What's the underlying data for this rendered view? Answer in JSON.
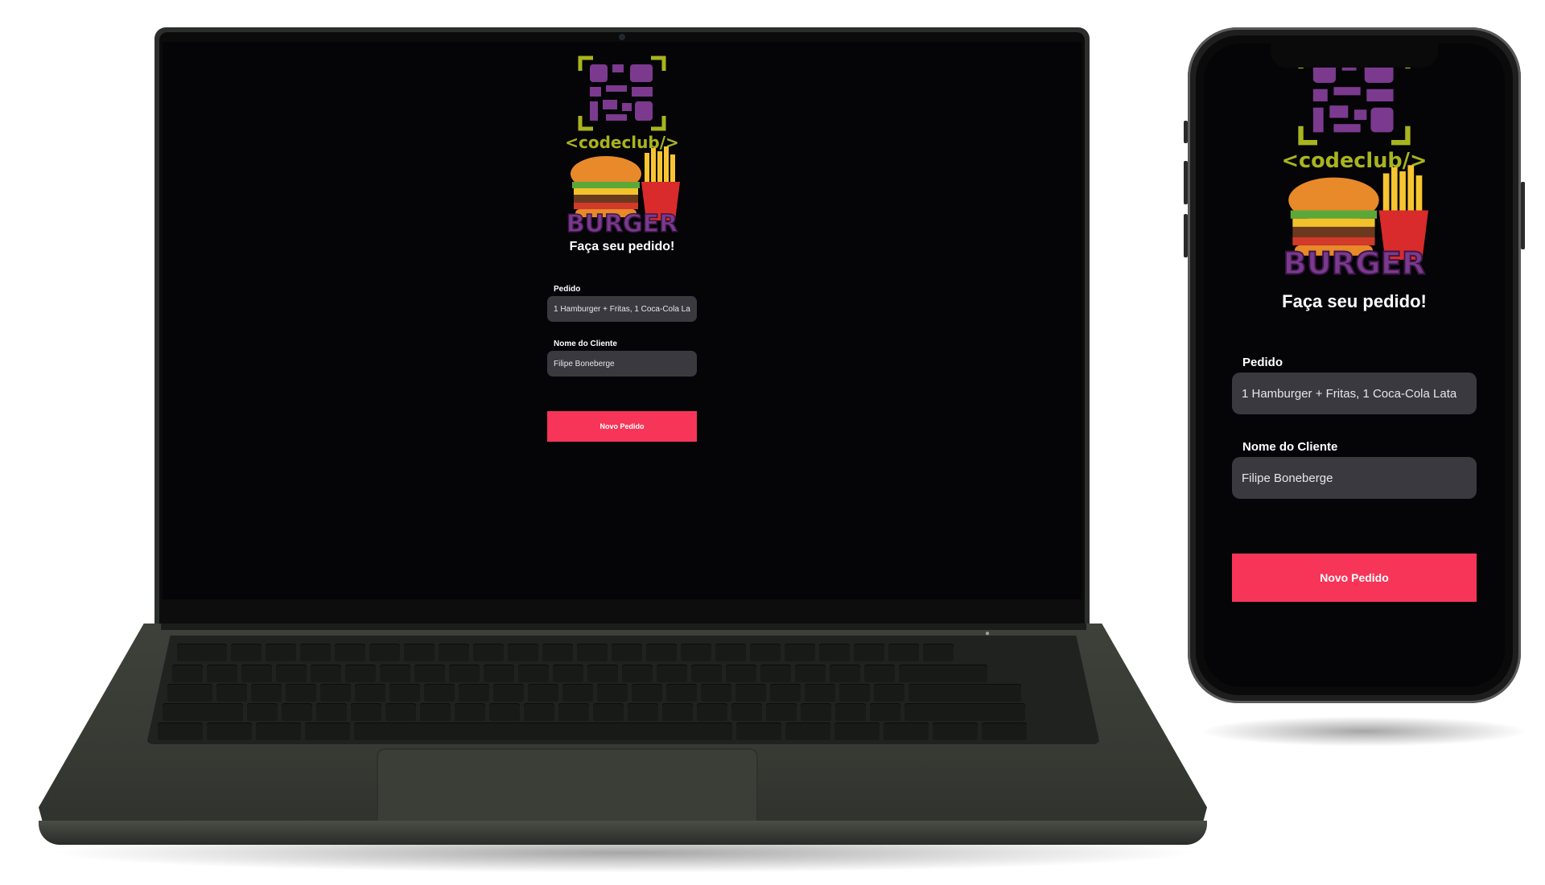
{
  "app": {
    "logo_text": "<codeclub/>",
    "logo_word": "BURGER",
    "title": "Faça seu pedido!",
    "order_label": "Pedido",
    "order_value": "1 Hamburger + Fritas, 1 Coca-Cola Lata",
    "customer_label": "Nome do Cliente",
    "customer_value": "Filipe Boneberge",
    "submit_label": "Novo Pedido"
  },
  "colors": {
    "background": "#050407",
    "input_bg": "#3a393f",
    "accent": "#f73558",
    "logo_purple": "#7b3a8e",
    "logo_lime": "#a8b41e"
  }
}
